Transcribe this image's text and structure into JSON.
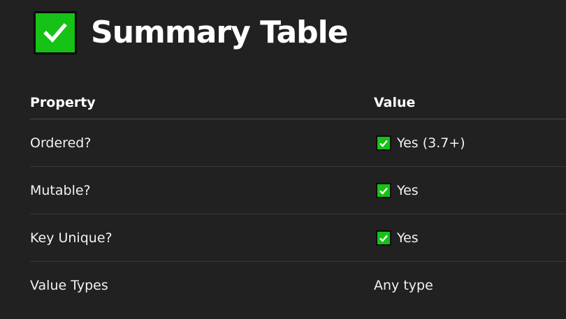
{
  "heading": {
    "icon": "check-mark-button-icon",
    "icon_color": "#15c215",
    "title": "Summary Table"
  },
  "table": {
    "columns": [
      "Property",
      "Value"
    ],
    "rows": [
      {
        "property": "Ordered?",
        "value": "Yes (3.7+)",
        "icon": "check-mark-button-icon"
      },
      {
        "property": "Mutable?",
        "value": "Yes",
        "icon": "check-mark-button-icon"
      },
      {
        "property": "Key Unique?",
        "value": "Yes",
        "icon": "check-mark-button-icon"
      },
      {
        "property": "Value Types",
        "value": "Any type",
        "icon": ""
      }
    ]
  }
}
